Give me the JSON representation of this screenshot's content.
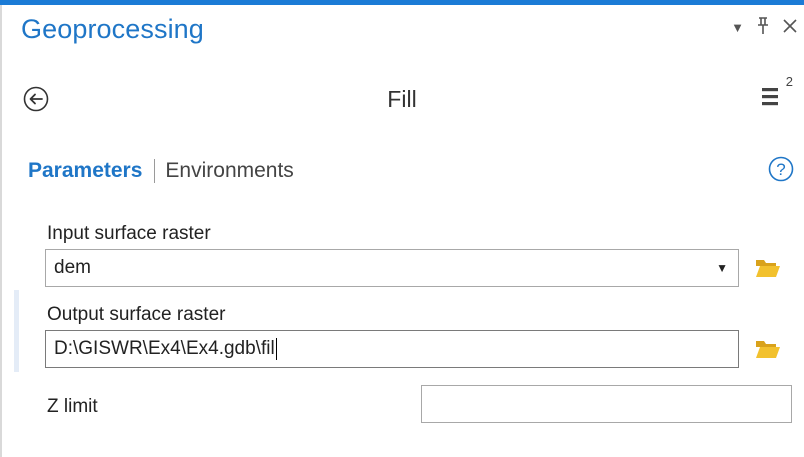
{
  "pane": {
    "title": "Geoprocessing",
    "controls": {
      "dropdown_icon": "caret-down-icon",
      "pin_icon": "pin-icon",
      "close_icon": "close-icon"
    }
  },
  "tool": {
    "name": "Fill",
    "back_icon": "back-arrow-icon",
    "menu_icon": "menu-icon",
    "menu_badge": "2"
  },
  "tabs": [
    {
      "label": "Parameters",
      "active": true
    },
    {
      "label": "Environments",
      "active": false
    }
  ],
  "help_icon": "help-icon",
  "parameters": {
    "input_surface_raster": {
      "label": "Input surface raster",
      "value": "dem",
      "browse_icon": "folder-icon"
    },
    "output_surface_raster": {
      "label": "Output surface raster",
      "value": "D:\\GISWR\\Ex4\\Ex4.gdb\\fil",
      "browse_icon": "folder-icon"
    },
    "z_limit": {
      "label": "Z limit",
      "value": ""
    }
  },
  "colors": {
    "accent": "#1f76c7",
    "top_bar": "#1b7bd6",
    "folder": "#f2c12e"
  }
}
